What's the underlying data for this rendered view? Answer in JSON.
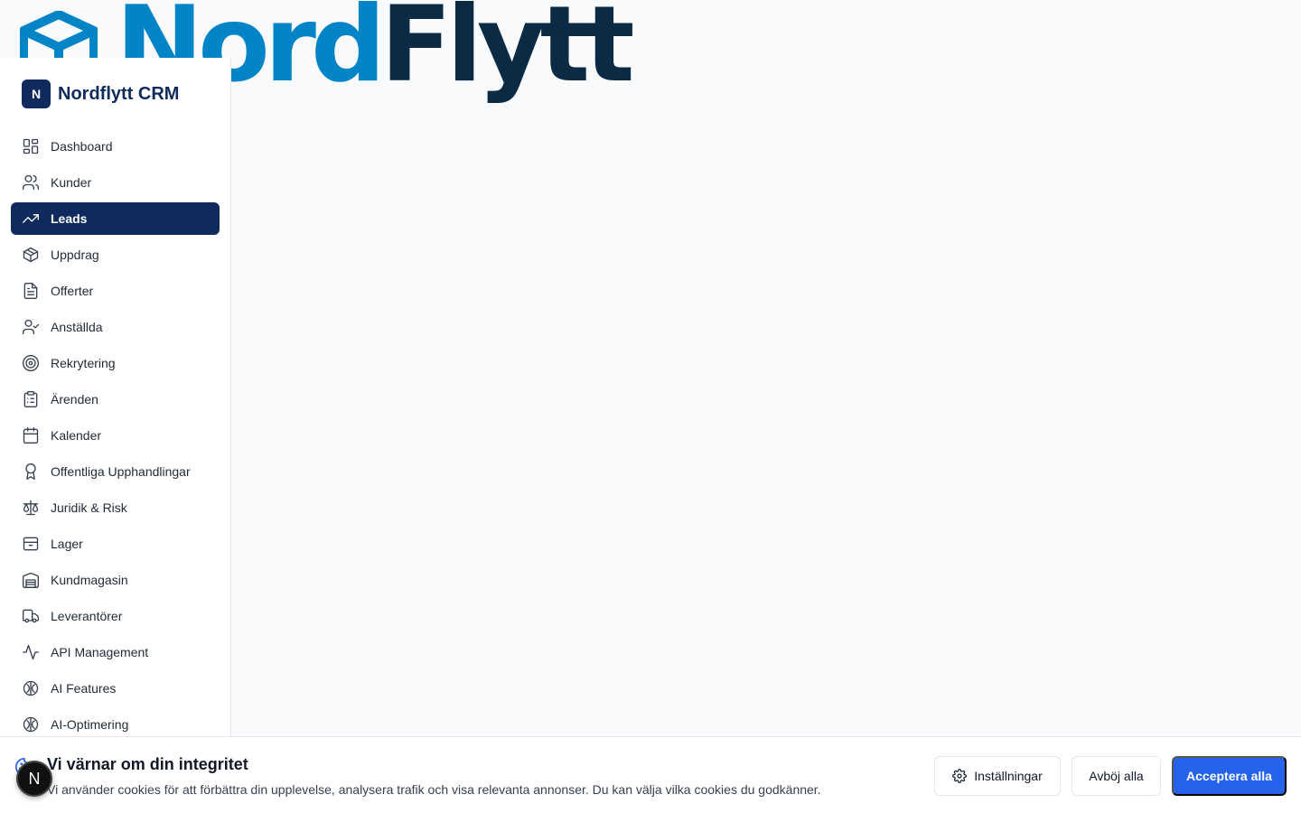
{
  "brand": {
    "wordmark_part1": "Nord",
    "wordmark_part2": "Flytt",
    "primary_color": "#0284c7",
    "dark_color": "#0b2a44"
  },
  "sidebar": {
    "logo_letter": "N",
    "app_name": "Nordflytt CRM",
    "active_color": "#0f2a5c",
    "items": [
      {
        "label": "Dashboard",
        "icon": "dashboard-icon"
      },
      {
        "label": "Kunder",
        "icon": "users-icon"
      },
      {
        "label": "Leads",
        "icon": "trending-up-icon",
        "active": true
      },
      {
        "label": "Uppdrag",
        "icon": "package-icon"
      },
      {
        "label": "Offerter",
        "icon": "file-text-icon"
      },
      {
        "label": "Anställda",
        "icon": "user-check-icon"
      },
      {
        "label": "Rekrytering",
        "icon": "target-icon"
      },
      {
        "label": "Ärenden",
        "icon": "clipboard-list-icon"
      },
      {
        "label": "Kalender",
        "icon": "calendar-icon"
      },
      {
        "label": "Offentliga Upphandlingar",
        "icon": "award-icon"
      },
      {
        "label": "Juridik & Risk",
        "icon": "scale-icon"
      },
      {
        "label": "Lager",
        "icon": "archive-icon"
      },
      {
        "label": "Kundmagasin",
        "icon": "warehouse-icon"
      },
      {
        "label": "Leverantörer",
        "icon": "truck-icon"
      },
      {
        "label": "API Management",
        "icon": "activity-icon"
      },
      {
        "label": "AI Features",
        "icon": "brain-icon"
      },
      {
        "label": "AI-Optimering",
        "icon": "brain-icon"
      }
    ]
  },
  "cookie_banner": {
    "title": "Vi värnar om din integritet",
    "text": "Vi använder cookies för att förbättra din upplevelse, analysera trafik och visa relevanta annonser. Du kan välja vilka cookies du godkänner.",
    "settings_label": "Inställningar",
    "reject_label": "Avböj alla",
    "accept_label": "Acceptera alla",
    "accept_color": "#2563eb"
  },
  "dev_badge": {
    "letter": "N"
  }
}
